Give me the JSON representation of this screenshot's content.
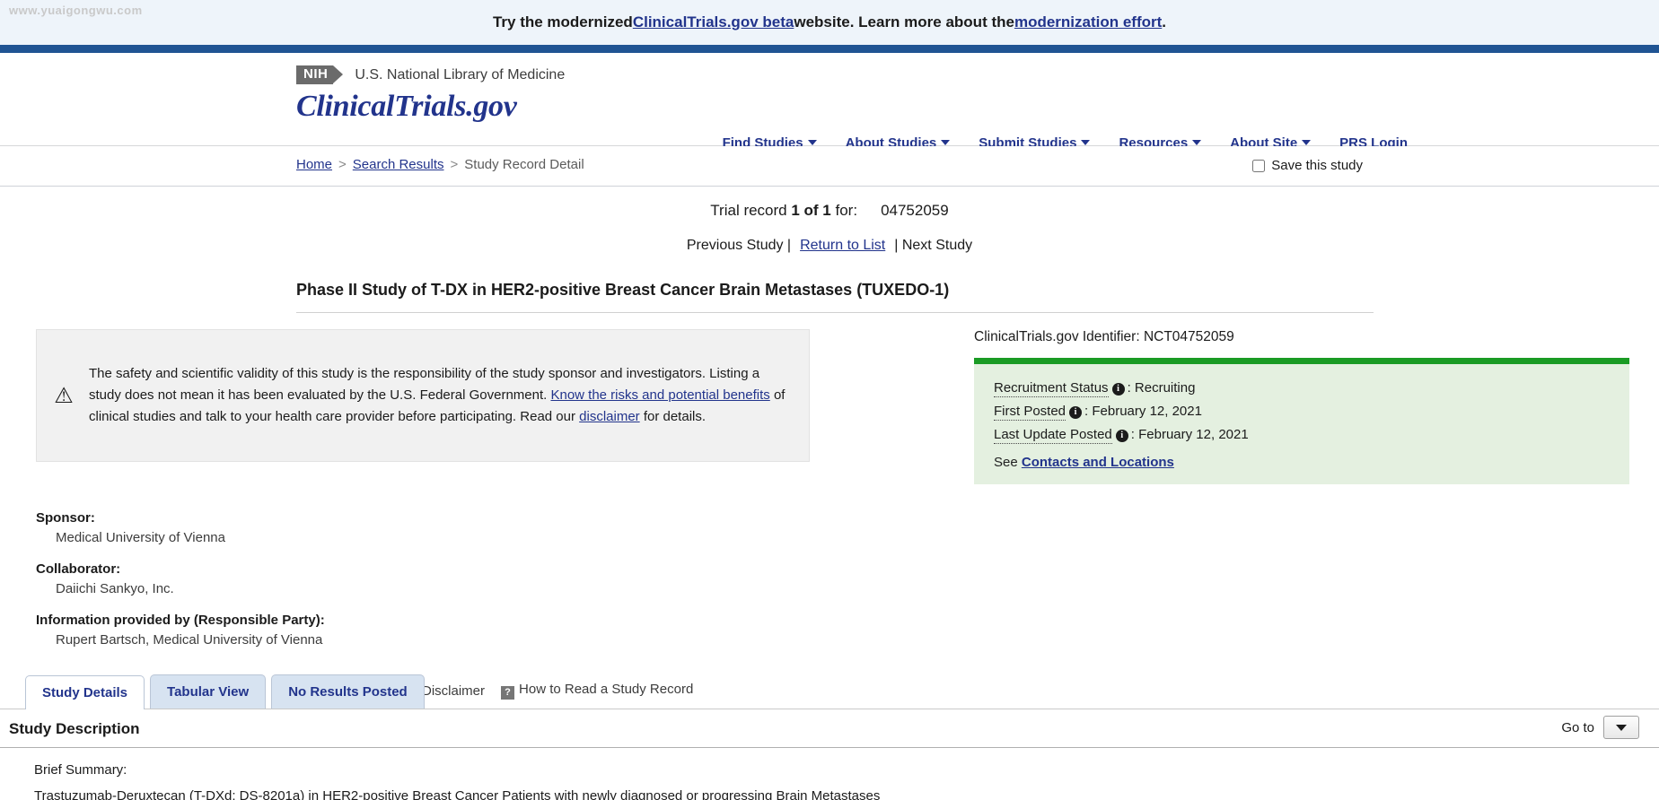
{
  "watermark": "www.yuaigongwu.com",
  "beta_banner": {
    "pre": "Try the modernized ",
    "link1": "ClinicalTrials.gov beta",
    "mid": " website. Learn more about the ",
    "link2": "modernization effort",
    "post": "."
  },
  "header": {
    "nih_logo": "NIH",
    "agency": "U.S. National Library of Medicine",
    "site_logo": "ClinicalTrials.gov",
    "nav": [
      {
        "label": "Find Studies",
        "has_caret": true
      },
      {
        "label": "About Studies",
        "has_caret": true
      },
      {
        "label": "Submit Studies",
        "has_caret": true
      },
      {
        "label": "Resources",
        "has_caret": true
      },
      {
        "label": "About Site",
        "has_caret": true
      },
      {
        "label": "PRS Login",
        "has_caret": false
      }
    ]
  },
  "breadcrumb": {
    "home": "Home",
    "sep1": ">",
    "search_results": "Search Results",
    "sep2": ">",
    "current": "Study Record Detail"
  },
  "save_study": {
    "label": "Save this study",
    "checked": false
  },
  "record": {
    "prefix": "Trial record ",
    "position": "1 of 1",
    "for_label": " for:",
    "query_id": "04752059",
    "previous": "Previous Study |",
    "return_to_list": "Return to List",
    "next": "| Next Study"
  },
  "study_title": "Phase II Study of T-DX in HER2-positive Breast Cancer Brain Metastases (TUXEDO-1)",
  "disclaimer": {
    "icon": "warning-icon",
    "part1": "The safety and scientific validity of this study is the responsibility of the study sponsor and investigators. Listing a study does not mean it has been evaluated by the U.S. Federal Government. ",
    "link1": "Know the risks and potential benefits",
    "part2": " of clinical studies and talk to your health care provider before participating. Read our ",
    "link2": "disclaimer",
    "part3": " for details."
  },
  "status": {
    "identifier_label": "ClinicalTrials.gov Identifier: ",
    "identifier_value": "NCT04752059",
    "rows": [
      {
        "label": "Recruitment Status",
        "value": "Recruiting"
      },
      {
        "label": "First Posted",
        "value": "February 12, 2021"
      },
      {
        "label": "Last Update Posted",
        "value": "February 12, 2021"
      }
    ],
    "see_label": "See ",
    "see_link": "Contacts and Locations",
    "accent_color": "#1a9b24",
    "background_color": "#e4f0e0"
  },
  "sponsor_block": [
    {
      "label": "Sponsor:",
      "value": "Medical University of Vienna"
    },
    {
      "label": "Collaborator:",
      "value": "Daiichi Sankyo, Inc."
    },
    {
      "label": "Information provided by (Responsible Party):",
      "value": "Rupert Bartsch, Medical University of Vienna"
    }
  ],
  "tabs": [
    {
      "label": "Study Details",
      "active": true
    },
    {
      "label": "Tabular View",
      "active": false
    },
    {
      "label": "No Results Posted",
      "active": false
    }
  ],
  "tab_links": {
    "disclaimer": "Disclaimer",
    "help_icon": "question-mark-icon",
    "how_to_read": "How to Read a Study Record"
  },
  "study_description": {
    "heading": "Study Description",
    "goto_label": "Go to",
    "brief_summary_label": "Brief Summary:",
    "brief_summary_text": "Trastuzumab-Deruxtecan (T-DXd; DS-8201a) in HER2-positive Breast Cancer Patients with newly diagnosed or progressing Brain Metastases"
  }
}
